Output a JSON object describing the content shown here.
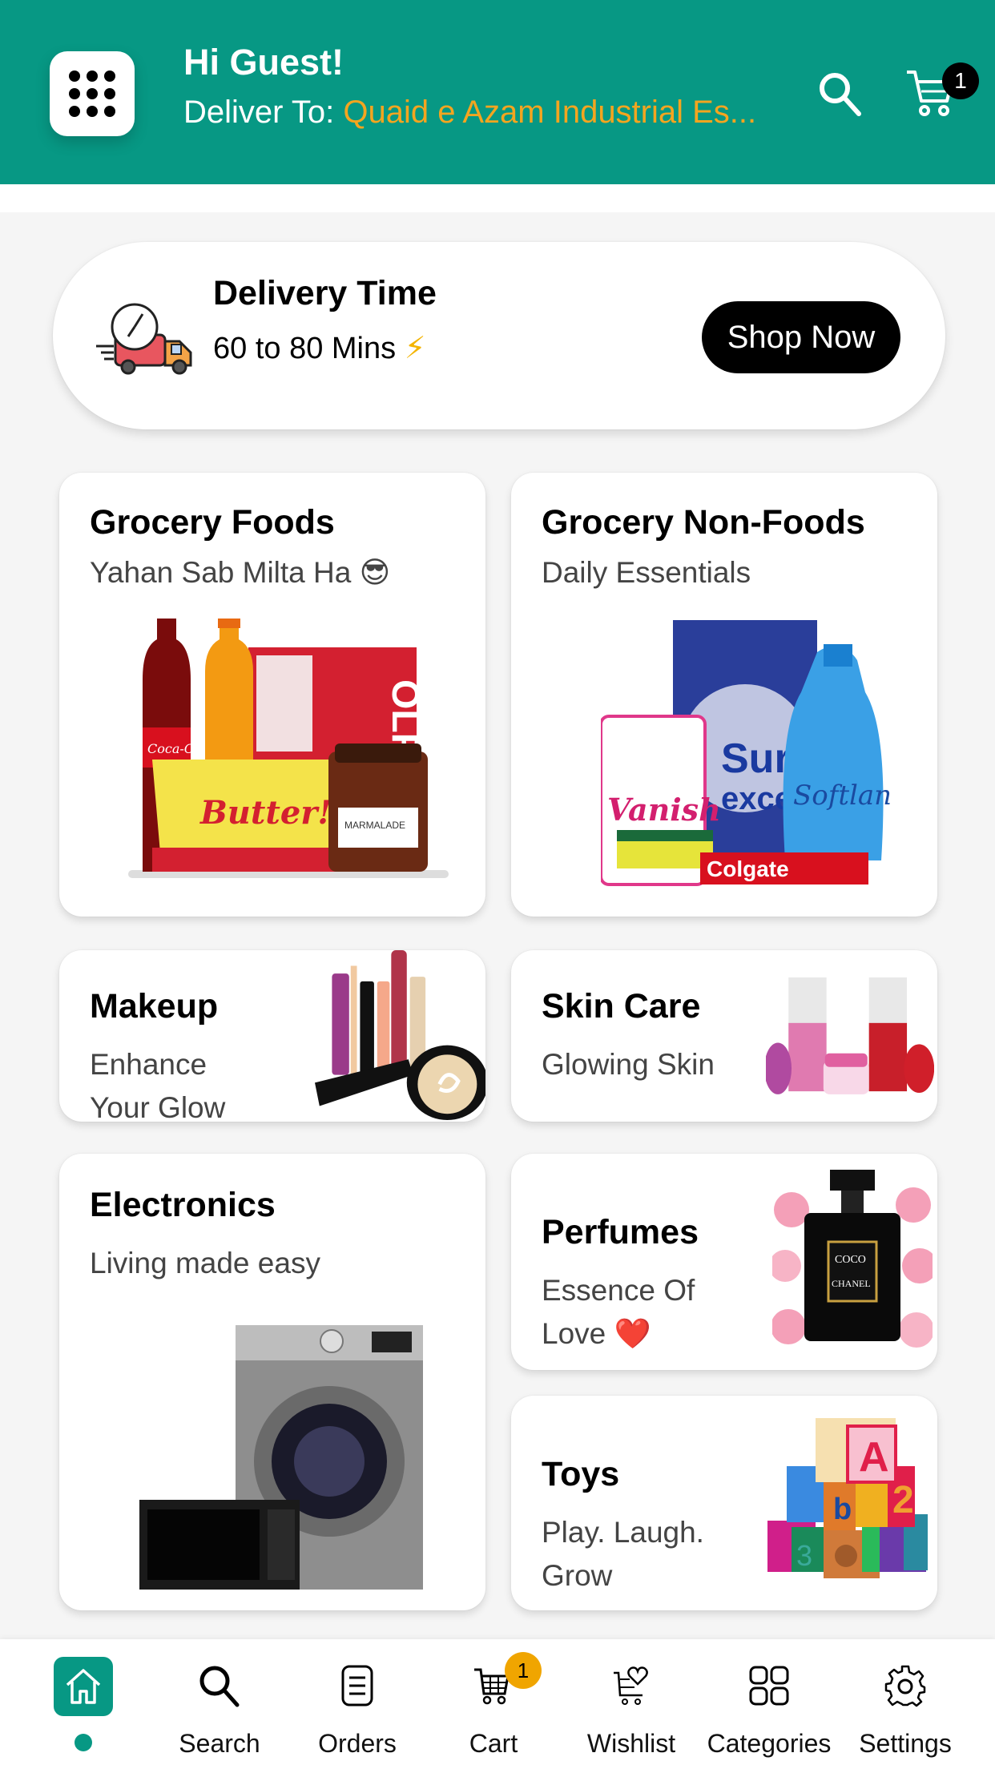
{
  "header": {
    "greeting": "Hi Guest!",
    "deliver_label": "Deliver To: ",
    "address": "Quaid e Azam Industrial Es...",
    "cart_count": "1",
    "brand_color": "#079884",
    "address_color": "#f4a51f"
  },
  "delivery": {
    "title": "Delivery Time",
    "time": "60 to 80 Mins",
    "bolt": "⚡",
    "shop_now_label": "Shop Now"
  },
  "categories": [
    {
      "title": "Grocery Foods",
      "subtitle": "Yahan Sab Milta Ha 😎",
      "image": "grocery-foods-products"
    },
    {
      "title": "Grocery Non-Foods",
      "subtitle": "Daily Essentials",
      "image": "household-products"
    },
    {
      "title": "Makeup",
      "subtitle_line1": "Enhance",
      "subtitle_line2": "Your Glow",
      "image": "makeup-products"
    },
    {
      "title": "Skin Care",
      "subtitle": "Glowing Skin",
      "image": "skin-care-products"
    },
    {
      "title": "Electronics",
      "subtitle": "Living made easy",
      "image": "washing-machine-microwave"
    },
    {
      "title": "Perfumes",
      "subtitle_line1": "Essence Of",
      "subtitle_line2": "Love ❤️",
      "image": "perfume-bottle"
    },
    {
      "title": "Toys",
      "subtitle_line1": "Play. Laugh.",
      "subtitle_line2": "Grow",
      "image": "toy-blocks"
    }
  ],
  "bottom_nav": {
    "items": [
      {
        "label": "",
        "icon": "home-icon",
        "active": true
      },
      {
        "label": "Search",
        "icon": "search-icon"
      },
      {
        "label": "Orders",
        "icon": "orders-icon"
      },
      {
        "label": "Cart",
        "icon": "cart-icon",
        "badge": "1"
      },
      {
        "label": "Wishlist",
        "icon": "wishlist-icon"
      },
      {
        "label": "Categories",
        "icon": "categories-icon"
      },
      {
        "label": "Settings",
        "icon": "settings-icon"
      }
    ]
  }
}
